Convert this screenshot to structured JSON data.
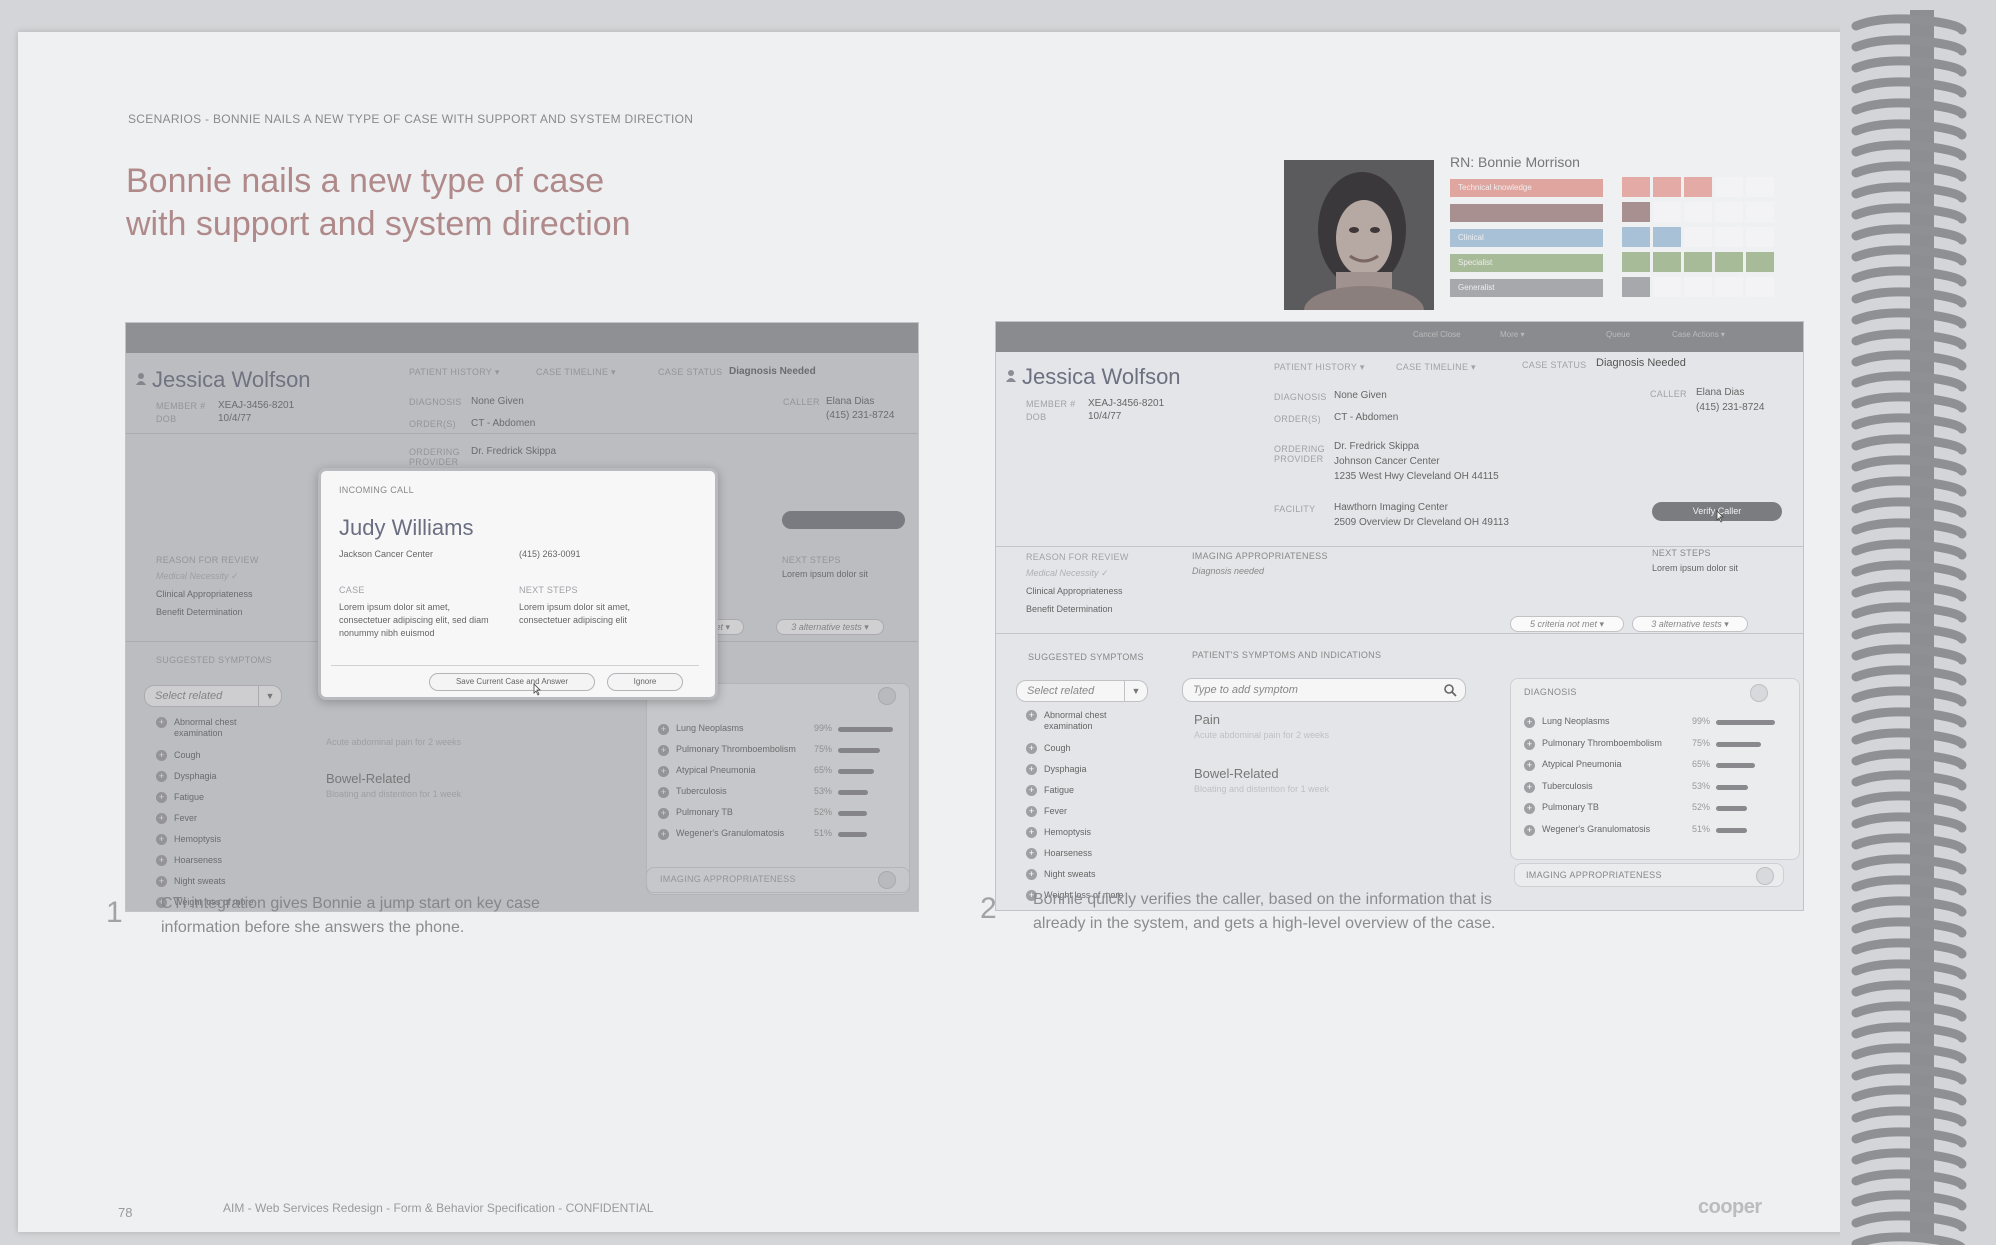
{
  "header_label": "SCENARIOS - BONNIE NAILS A NEW TYPE OF CASE WITH SUPPORT AND SYSTEM DIRECTION",
  "title_lines": [
    "Bonnie nails a new type of case",
    "with support and system direction"
  ],
  "persona": {
    "name": "RN: Bonnie Morrison",
    "skills": [
      {
        "label": "Technical knowledge",
        "color": "#e1a5a0",
        "grid_colors": [
          "#e3aaa6",
          "#e3aaa6",
          "#e3aaa6"
        ]
      },
      {
        "label": "",
        "color": "#a89090",
        "grid_colors": [
          "#a89090"
        ]
      },
      {
        "label": "Clinical",
        "color": "#a8c1d6",
        "grid_colors": [
          "#a8c1d6",
          "#a8c1d6"
        ]
      },
      {
        "label": "Specialist",
        "color": "#a8bb98",
        "grid_colors": [
          "#a8bb98",
          "#a8bb98",
          "#a8bb98",
          "#a8bb98",
          "#a8bb98"
        ]
      },
      {
        "label": "Generalist",
        "color": "#a7a8ac",
        "grid_colors": [
          "#a7a8ac"
        ]
      }
    ]
  },
  "screen1": {
    "patient_name": "Jessica Wolfson",
    "member_label": "MEMBER #",
    "member_value": "XEAJ-3456-8201",
    "dob_label": "DOB",
    "dob_value": "10/4/77",
    "tab_history": "PATIENT HISTORY ▾",
    "tab_timeline": "CASE TIMELINE ▾",
    "case_status_label": "CASE STATUS",
    "case_status_value": "Diagnosis Needed",
    "diagnosis_label": "DIAGNOSIS",
    "diagnosis_value": "None Given",
    "orders_label": "ORDER(S)",
    "orders_value": "CT - Abdomen",
    "ordering_label": "ORDERING PROVIDER",
    "ordering_value": "Dr. Fredrick Skippa",
    "caller_label": "CALLER",
    "caller_name": "Elana Dias",
    "caller_phone": "(415) 231-8724",
    "reason_label": "REASON FOR REVIEW",
    "reasons": [
      "Medical Necessity ✓",
      "Clinical Appropriateness",
      "Benefit Determination"
    ],
    "next_steps_label": "NEXT STEPS",
    "next_steps_value": "Lorem ipsum dolor sit",
    "suggested_label": "SUGGESTED SYMPTOMS",
    "select_placeholder": "Select related",
    "symptoms": [
      "Abnormal chest examination",
      "Cough",
      "Dysphagia",
      "Fatigue",
      "Fever",
      "Hemoptysis",
      "Hoarseness",
      "Night sweats",
      "Weight loss of more"
    ],
    "pain_detail": "Acute abdominal pain for 2 weeks",
    "bowel_label": "Bowel-Related",
    "bowel_detail": "Bloating and distention for 1 week",
    "diagnoses": [
      {
        "name": "Lung Neoplasms",
        "pct": "99%",
        "v": 0.99
      },
      {
        "name": "Pulmonary Thromboembolism",
        "pct": "75%",
        "v": 0.75
      },
      {
        "name": "Atypical Pneumonia",
        "pct": "65%",
        "v": 0.65
      },
      {
        "name": "Tuberculosis",
        "pct": "53%",
        "v": 0.53
      },
      {
        "name": "Pulmonary TB",
        "pct": "52%",
        "v": 0.52
      },
      {
        "name": "Wegener's Granulomatosis",
        "pct": "51%",
        "v": 0.51
      }
    ],
    "imaging_label": "IMAGING APPROPRIATENESS",
    "pill_text": "3 alternative tests ▾",
    "pill_text_left": "met ▾",
    "modal": {
      "heading": "INCOMING CALL",
      "caller_name": "Judy Williams",
      "caller_org": "Jackson Cancer Center",
      "caller_phone": "(415) 263-0091",
      "case_label": "CASE",
      "case_text": "Lorem ipsum dolor sit amet, consectetuer adipiscing elit, sed diam nonummy nibh euismod",
      "next_label": "NEXT STEPS",
      "next_text": "Lorem ipsum dolor sit amet, consectetuer adipiscing elit",
      "save_button": "Save Current Case and Answer",
      "ignore_button": "Ignore"
    }
  },
  "screen2": {
    "topbar_items": [
      "Cancel Close",
      "More ▾",
      "Queue",
      "Case Actions ▾"
    ],
    "patient_name": "Jessica Wolfson",
    "member_label": "MEMBER #",
    "member_value": "XEAJ-3456-8201",
    "dob_label": "DOB",
    "dob_value": "10/4/77",
    "tab_history": "PATIENT HISTORY ▾",
    "tab_timeline": "CASE TIMELINE ▾",
    "case_status_label": "CASE STATUS",
    "case_status_value": "Diagnosis Needed",
    "diagnosis_label": "DIAGNOSIS",
    "diagnosis_value": "None Given",
    "orders_label": "ORDER(S)",
    "orders_value": "CT - Abdomen",
    "ordering_label": "ORDERING PROVIDER",
    "ordering_lines": [
      "Dr. Fredrick Skippa",
      "Johnson Cancer Center",
      "1235 West Hwy Cleveland OH 44115"
    ],
    "facility_label": "FACILITY",
    "facility_lines": [
      "Hawthorn Imaging Center",
      "2509 Overview Dr Cleveland OH 49113"
    ],
    "caller_label": "CALLER",
    "caller_name": "Elana Dias",
    "caller_phone": "(415) 231-8724",
    "verify_button": "Verify Caller",
    "reason_label": "REASON FOR REVIEW",
    "reasons": [
      "Medical Necessity ✓",
      "Clinical Appropriateness",
      "Benefit Determination"
    ],
    "imaging_label": "IMAGING APPROPRIATENESS",
    "imaging_value": "Diagnosis needed",
    "next_steps_label": "NEXT STEPS",
    "next_steps_value": "Lorem ipsum dolor sit",
    "pill_criteria": "5 criteria not met ▾",
    "pill_tests": "3 alternative tests ▾",
    "suggested_label": "SUGGESTED SYMPTOMS",
    "indications_label": "PATIENT'S SYMPTOMS AND INDICATIONS",
    "select_placeholder": "Select related",
    "symptom_search_placeholder": "Type to add symptom",
    "symptoms": [
      "Abnormal chest examination",
      "Cough",
      "Dysphagia",
      "Fatigue",
      "Fever",
      "Hemoptysis",
      "Hoarseness",
      "Night sweats",
      "Weight loss of more"
    ],
    "pain_label": "Pain",
    "pain_detail": "Acute abdominal pain for 2 weeks",
    "bowel_label": "Bowel-Related",
    "bowel_detail": "Bloating and distention for 1 week",
    "diagnosis_panel_label": "DIAGNOSIS",
    "diagnoses": [
      {
        "name": "Lung Neoplasms",
        "pct": "99%",
        "v": 0.99
      },
      {
        "name": "Pulmonary Thromboembolism",
        "pct": "75%",
        "v": 0.75
      },
      {
        "name": "Atypical Pneumonia",
        "pct": "65%",
        "v": 0.65
      },
      {
        "name": "Tuberculosis",
        "pct": "53%",
        "v": 0.53
      },
      {
        "name": "Pulmonary TB",
        "pct": "52%",
        "v": 0.52
      },
      {
        "name": "Wegener's Granulomatosis",
        "pct": "51%",
        "v": 0.51
      }
    ],
    "imaging_panel_label": "IMAGING APPROPRIATENESS"
  },
  "captions": [
    {
      "num": "1",
      "text": "CTI integration gives Bonnie a jump start on key case information before she answers the phone."
    },
    {
      "num": "2",
      "text": "Bonnie quickly verifies the caller, based on the information that is already in the system, and gets a high-level overview of the case."
    }
  ],
  "footer": {
    "page_number": "78",
    "text": "AIM - Web Services Redesign - Form & Behavior Specification - CONFIDENTIAL",
    "logo": "cooper"
  }
}
